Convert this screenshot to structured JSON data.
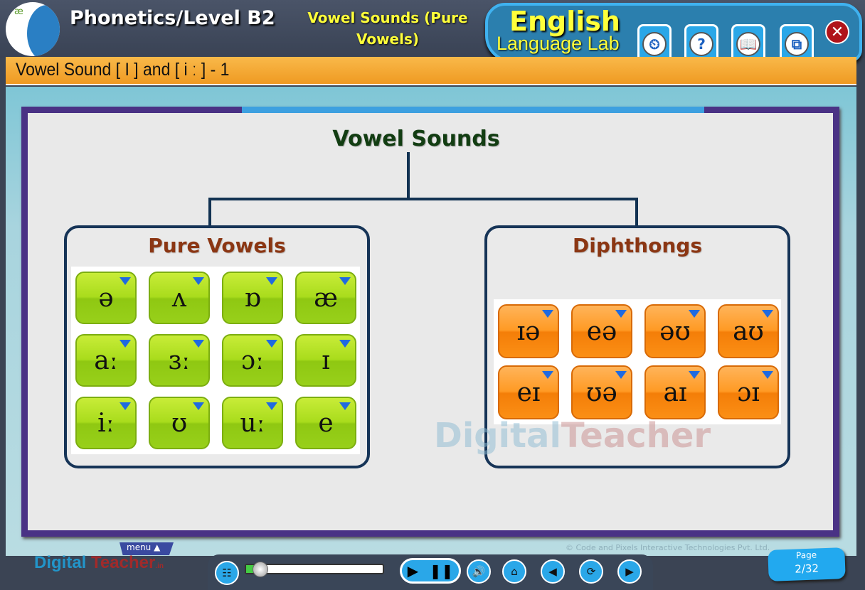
{
  "header": {
    "breadcrumb": "Phonetics/Level B2",
    "subtitle": "Vowel Sounds (Pure Vowels)",
    "brand_top": "English",
    "brand_bottom": "Language Lab",
    "toolbar": [
      {
        "icon": "folder-clock-icon",
        "label": ""
      },
      {
        "icon": "help-icon",
        "label": "?"
      },
      {
        "icon": "book-icon",
        "label": ""
      },
      {
        "icon": "resize-icon",
        "label": ""
      }
    ],
    "close_icon": "close-icon"
  },
  "lesson_title": "Vowel Sound [ I ] and [ i ː ] - 1",
  "diagram": {
    "title": "Vowel Sounds",
    "pure_vowels": {
      "title": "Pure Vowels",
      "keys": [
        "ə",
        "ʌ",
        "ɒ",
        "æ",
        "aː",
        "ɜː",
        "ɔː",
        "ɪ",
        "iː",
        "ʊ",
        "uː",
        "e"
      ],
      "color": "#a9dc1c"
    },
    "diphthongs": {
      "title": "Diphthongs",
      "keys": [
        "ɪə",
        "eə",
        "əʊ",
        "aʊ",
        "eɪ",
        "ʊə",
        "aɪ",
        "ɔɪ"
      ],
      "color": "#ff9a24"
    }
  },
  "watermark": {
    "a": "Digital",
    "b": "Teacher",
    ".in": ".in"
  },
  "footer": {
    "logo_a": "Digital",
    "logo_b": "Teacher",
    "logo_c": ".in",
    "menu": "menu ▲",
    "copyright": "© Code and Pixels Interactive Technologies  Pvt. Ltd. All Rights Reserved",
    "progress": 0.1,
    "page_label": "Page",
    "page_num": "2/32"
  }
}
